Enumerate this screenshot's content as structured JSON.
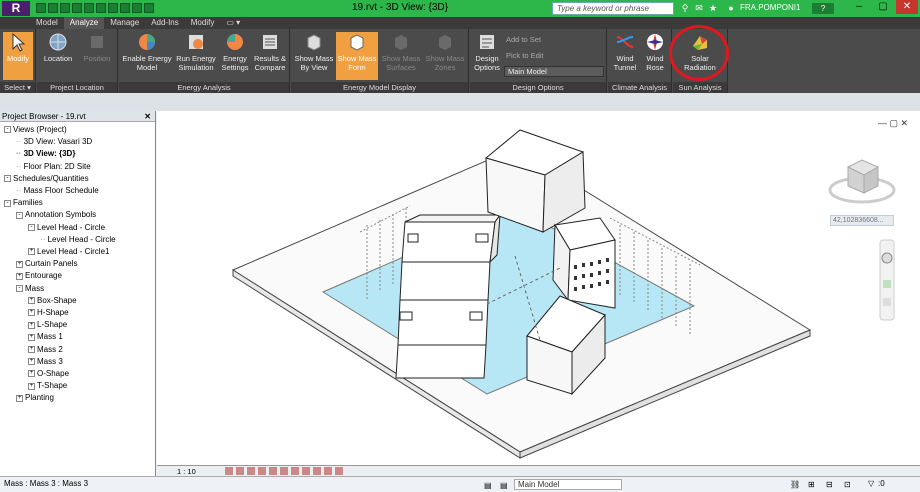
{
  "window": {
    "app_logo": "R",
    "title": "19.rvt - 3D View: {3D}",
    "search_placeholder": "Type a keyword or phrase",
    "user": "FRA.POMPONI1",
    "help": "?"
  },
  "tabs": [
    "Model",
    "Analyze",
    "Manage",
    "Add-Ins",
    "Modify"
  ],
  "active_tab": "Analyze",
  "ribbon": {
    "panels": [
      {
        "caption": "Select ▾",
        "buttons": [
          {
            "label": "Modify",
            "state": "highlighted"
          }
        ]
      },
      {
        "caption": "Project Location",
        "buttons": [
          {
            "label": "Location",
            "state": "normal"
          },
          {
            "label": "Position",
            "state": "dim"
          }
        ]
      },
      {
        "caption": "Energy Analysis",
        "buttons": [
          {
            "label": "Enable Energy Model",
            "state": "normal"
          },
          {
            "label": "Run Energy Simulation",
            "state": "normal"
          },
          {
            "label": "Energy Settings",
            "state": "normal"
          },
          {
            "label": "Results & Compare",
            "state": "normal"
          }
        ]
      },
      {
        "caption": "Energy Model Display",
        "buttons": [
          {
            "label": "Show Mass By View",
            "state": "normal"
          },
          {
            "label": "Show Mass Form",
            "state": "highlighted"
          },
          {
            "label": "Show Mass Surfaces",
            "state": "dim"
          },
          {
            "label": "Show Mass Zones",
            "state": "dim"
          }
        ]
      },
      {
        "caption": "Design Options",
        "buttons": [
          {
            "label": "Design Options",
            "state": "normal"
          }
        ]
      },
      {
        "caption": "Climate Analysis",
        "buttons": [
          {
            "label": "Wind Tunnel",
            "state": "normal"
          },
          {
            "label": "Wind Rose",
            "state": "normal"
          }
        ]
      },
      {
        "caption": "Sun Analysis",
        "buttons": [
          {
            "label": "Solar Radiation",
            "state": "normal"
          }
        ]
      }
    ],
    "design_options": {
      "add_to_set": "Add to Set",
      "pick_to_edit": "Pick to Edit",
      "main_model": "Main Model"
    }
  },
  "project_browser": {
    "title": "Project Browser - 19.rvt",
    "close": "✕",
    "items": [
      {
        "label": "Views (Project)",
        "level": 0,
        "expander": "-",
        "bold": false
      },
      {
        "label": "3D View: Vasari 3D",
        "level": 1,
        "expander": "",
        "bold": false
      },
      {
        "label": "3D View: {3D}",
        "level": 1,
        "expander": "",
        "bold": true
      },
      {
        "label": "Floor Plan: 2D Site",
        "level": 1,
        "expander": "",
        "bold": false
      },
      {
        "label": "Schedules/Quantities",
        "level": 0,
        "expander": "-",
        "bold": false
      },
      {
        "label": "Mass Floor Schedule",
        "level": 1,
        "expander": "",
        "bold": false
      },
      {
        "label": "Families",
        "level": 0,
        "expander": "-",
        "bold": false
      },
      {
        "label": "Annotation Symbols",
        "level": 1,
        "expander": "-",
        "bold": false
      },
      {
        "label": "Level Head - Circle",
        "level": 2,
        "expander": "-",
        "bold": false
      },
      {
        "label": "Level Head - Circle",
        "level": 3,
        "expander": "",
        "bold": false
      },
      {
        "label": "Level Head - Circle1",
        "level": 2,
        "expander": "+",
        "bold": false
      },
      {
        "label": "Curtain Panels",
        "level": 1,
        "expander": "+",
        "bold": false
      },
      {
        "label": "Entourage",
        "level": 1,
        "expander": "+",
        "bold": false
      },
      {
        "label": "Mass",
        "level": 1,
        "expander": "-",
        "bold": false
      },
      {
        "label": "Box-Shape",
        "level": 2,
        "expander": "+",
        "bold": false
      },
      {
        "label": "H-Shape",
        "level": 2,
        "expander": "+",
        "bold": false
      },
      {
        "label": "L-Shape",
        "level": 2,
        "expander": "+",
        "bold": false
      },
      {
        "label": "Mass 1",
        "level": 2,
        "expander": "+",
        "bold": false
      },
      {
        "label": "Mass 2",
        "level": 2,
        "expander": "+",
        "bold": false
      },
      {
        "label": "Mass 3",
        "level": 2,
        "expander": "+",
        "bold": false
      },
      {
        "label": "O-Shape",
        "level": 2,
        "expander": "+",
        "bold": false
      },
      {
        "label": "T-Shape",
        "level": 2,
        "expander": "+",
        "bold": false
      },
      {
        "label": "Planting",
        "level": 1,
        "expander": "+",
        "bold": false
      }
    ]
  },
  "viewport": {
    "coordinate": "42,102836608..."
  },
  "view_bar": {
    "scale": "1 : 10"
  },
  "status_bar": {
    "text": "Mass : Mass 3 : Mass 3",
    "model": "Main Model",
    "filter": ":0"
  },
  "colors": {
    "ribbon": "#4b4b4b",
    "titlebar": "#2db64a",
    "highlight": "#f0a040",
    "annotation_circle": "#e0171c",
    "site_blue": "#b7e6f4"
  }
}
